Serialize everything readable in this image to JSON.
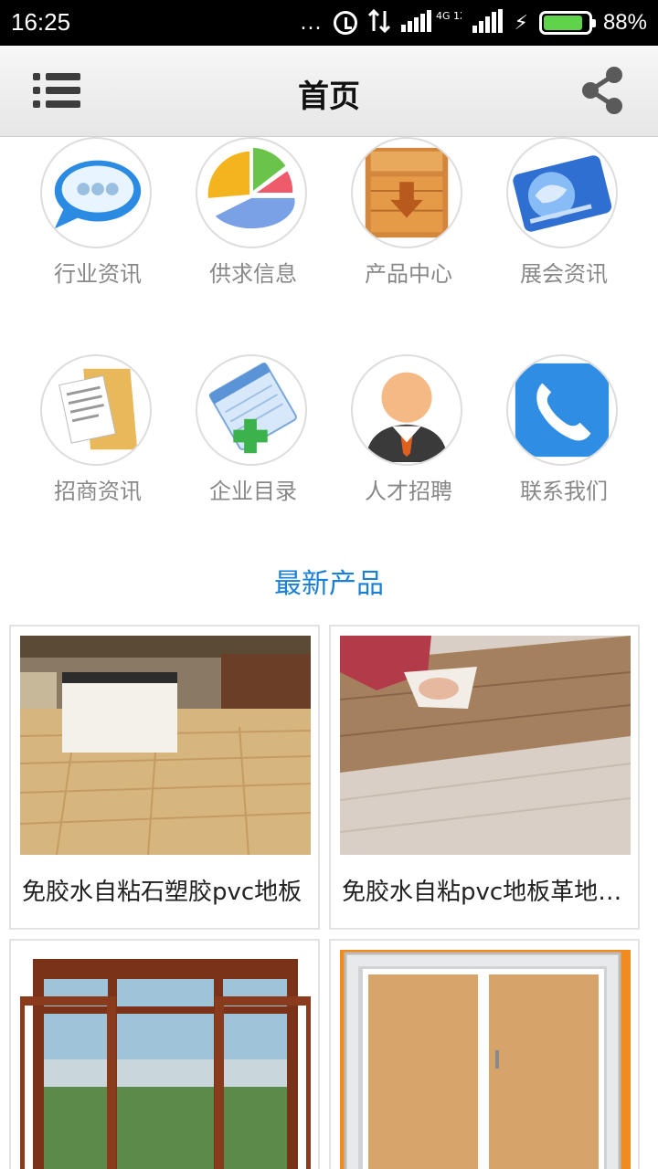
{
  "status_bar": {
    "time": "16:25",
    "dots": "...",
    "network": "4G 1X",
    "battery_percent": 88,
    "battery_label": "88%",
    "icons": [
      "alarm-icon",
      "data-transfer-icon",
      "signal-icon",
      "charging-icon",
      "battery-icon"
    ]
  },
  "header": {
    "title": "首页",
    "menu_icon": "list-menu-icon",
    "share_icon": "share-icon"
  },
  "categories": [
    {
      "label": "行业资讯",
      "icon": "chat-bubble-icon"
    },
    {
      "label": "供求信息",
      "icon": "pie-chart-icon"
    },
    {
      "label": "产品中心",
      "icon": "wooden-crate-icon"
    },
    {
      "label": "展会资讯",
      "icon": "globe-card-icon"
    },
    {
      "label": "招商资讯",
      "icon": "documents-folder-icon"
    },
    {
      "label": "企业目录",
      "icon": "notepad-add-icon"
    },
    {
      "label": "人才招聘",
      "icon": "person-icon"
    },
    {
      "label": "联系我们",
      "icon": "phone-icon"
    }
  ],
  "latest": {
    "title": "最新产品",
    "products": [
      {
        "name": "免胶水自粘石塑胶pvc地板",
        "image": "wood-floor-room-image"
      },
      {
        "name": "免胶水自粘pvc地板革地板贴",
        "image": "floor-sticker-peel-image"
      },
      {
        "name": "",
        "image": "casement-window-image"
      },
      {
        "name": "",
        "image": "sliding-window-image"
      }
    ]
  },
  "colors": {
    "accent": "#1a7fd6",
    "status_bar": "#000000",
    "header_bg": "#eeeeee",
    "label_gray": "#888888",
    "battery_green": "#5fd34a"
  }
}
